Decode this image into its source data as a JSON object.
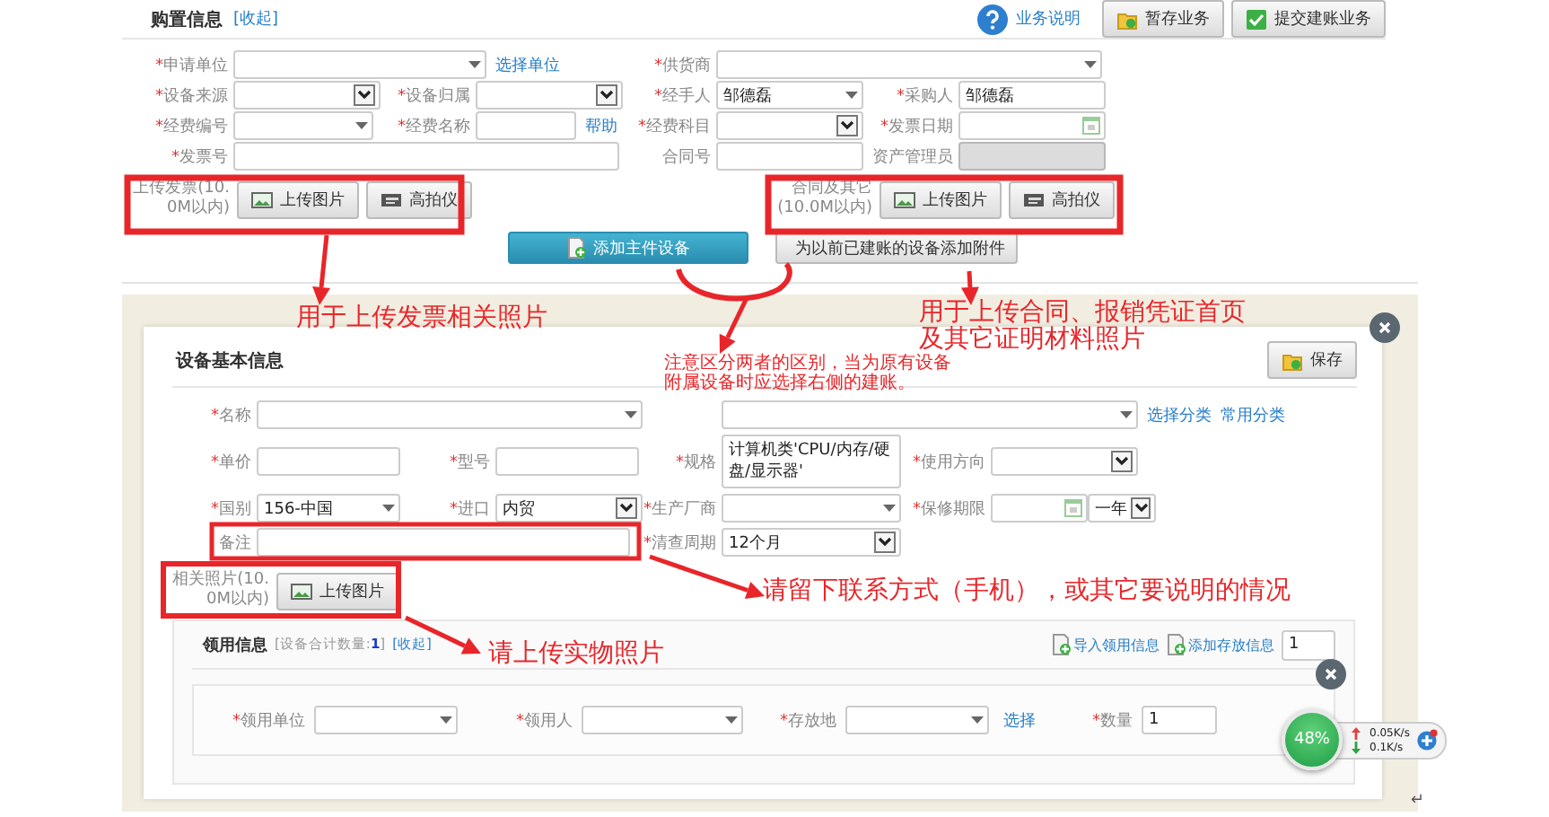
{
  "required_mark": "*",
  "purchase": {
    "title": "购置信息",
    "collapse": "[收起]",
    "help": "业务说明",
    "actions": [
      {
        "label": "暂存业务",
        "kind": "save"
      },
      {
        "label": "提交建账业务",
        "kind": "submit"
      }
    ],
    "fields": [
      {
        "label": "申请单位",
        "required": true,
        "kind": "combo",
        "disabled": false,
        "links": [
          "选择单位"
        ]
      },
      {
        "label": "供货商",
        "required": true,
        "kind": "combo",
        "disabled": false
      },
      {
        "label": "设备来源",
        "required": true,
        "kind": "select",
        "disabled": false
      },
      {
        "label": "设备归属",
        "required": true,
        "kind": "select",
        "disabled": false
      },
      {
        "label": "经手人",
        "required": true,
        "kind": "combo",
        "disabled": false,
        "value": "邹德磊"
      },
      {
        "label": "采购人",
        "required": true,
        "kind": "input",
        "disabled": false,
        "value": "邹德磊"
      },
      {
        "label": "经费编号",
        "required": true,
        "kind": "combo",
        "disabled": false
      },
      {
        "label": "经费名称",
        "required": true,
        "kind": "input",
        "disabled": false,
        "links": [
          "帮助"
        ]
      },
      {
        "label": "经费科目",
        "required": true,
        "kind": "select",
        "disabled": false
      },
      {
        "label": "发票日期",
        "required": true,
        "kind": "date",
        "disabled": false
      },
      {
        "label": "发票号",
        "required": true,
        "kind": "input",
        "disabled": false
      },
      {
        "label": "合同号",
        "required": false,
        "kind": "input",
        "disabled": false
      },
      {
        "label": "资产管理员",
        "required": false,
        "kind": "input",
        "disabled": true
      }
    ],
    "uploads": [
      {
        "label": "上传发票(10.0M以内)",
        "buttons": [
          {
            "label": "上传图片",
            "kind": "image"
          },
          {
            "label": "高拍仪",
            "kind": "camera"
          }
        ]
      },
      {
        "label": "合同及其它(10.0M以内)",
        "buttons": [
          {
            "label": "上传图片",
            "kind": "image"
          },
          {
            "label": "高拍仪",
            "kind": "camera"
          }
        ]
      }
    ],
    "add_buttons": [
      {
        "label": "添加主件设备",
        "kind": "primary"
      },
      {
        "label": "为以前已建账的设备添加附件",
        "kind": "secondary"
      }
    ]
  },
  "device": {
    "title": "设备基本信息",
    "save": "保存",
    "fields": [
      {
        "label": "名称",
        "required": true,
        "kind": "combo"
      },
      {
        "kind": "combo",
        "links": [
          "选择分类",
          "常用分类"
        ]
      },
      {
        "label": "单价",
        "required": true,
        "kind": "input"
      },
      {
        "label": "型号",
        "required": true,
        "kind": "input"
      },
      {
        "label": "规格",
        "required": true,
        "kind": "textarea",
        "value": "计算机类'CPU/内存/硬盘/显示器'"
      },
      {
        "label": "使用方向",
        "required": true,
        "kind": "select"
      },
      {
        "label": "国别",
        "required": true,
        "kind": "combo",
        "value": "156-中国"
      },
      {
        "label": "进口",
        "required": true,
        "kind": "select",
        "value": "内贸"
      },
      {
        "label": "生产厂商",
        "required": true,
        "kind": "combo"
      },
      {
        "label": "保修期限",
        "required": true,
        "kind": "date",
        "period": "一年"
      },
      {
        "label": "备注",
        "required": false,
        "kind": "input"
      },
      {
        "label": "清查周期",
        "required": true,
        "kind": "select",
        "value": "12个月"
      }
    ],
    "photo_upload": {
      "label": "相关照片(10.0M以内)",
      "button": "上传图片"
    }
  },
  "claim": {
    "title": "领用信息",
    "summary": "[设备合计数量:**1**]",
    "collapse": "[收起]",
    "actions": [
      "导入领用信息",
      "添加存放信息"
    ],
    "quantity": "1",
    "fields": [
      {
        "label": "领用单位",
        "required": true,
        "kind": "combo"
      },
      {
        "label": "领用人",
        "required": true,
        "kind": "combo"
      },
      {
        "label": "存放地",
        "required": true,
        "kind": "combo",
        "links": [
          "选择"
        ]
      },
      {
        "label": "数量",
        "required": true,
        "kind": "input",
        "value": "1"
      }
    ]
  },
  "annotations": [
    {
      "lines": [
        "用于上传发票相关照片"
      ]
    },
    {
      "lines": [
        "用于上传合同、报销凭证首页",
        "及其它证明材料照片"
      ]
    },
    {
      "lines": [
        "注意区分两者的区别，当为原有设备",
        "附属设备时应选择右侧的建账。"
      ]
    },
    {
      "lines": [
        "请留下联系方式（手机），或其它要说明的情况"
      ]
    },
    {
      "lines": [
        "请上传实物照片"
      ]
    }
  ],
  "speed_widget": {
    "percent": "48%",
    "up": "0.05K/s",
    "down": "0.1K/s"
  },
  "return_mark": "↵"
}
